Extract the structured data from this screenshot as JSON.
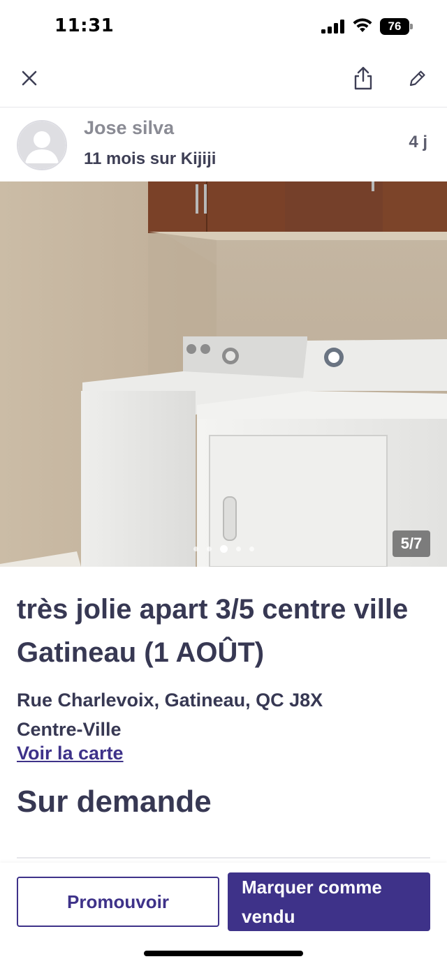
{
  "status_bar": {
    "time": "11:31",
    "battery": "76",
    "icons": [
      "signal-icon",
      "wifi-icon",
      "battery-icon"
    ]
  },
  "top_nav": {
    "icons": [
      "close-icon",
      "share-icon",
      "edit-icon"
    ]
  },
  "seller": {
    "name": "Jose silva",
    "member_since": "11 mois sur Kijiji",
    "posted_age": "4 j"
  },
  "gallery": {
    "counter": "5/7",
    "current_index": 5,
    "total": 7,
    "dot_count": 5,
    "active_dot": 2
  },
  "listing": {
    "title": "très jolie apart 3/5 centre ville Gatineau (1 AOÛT)",
    "address_line1": "Rue Charlevoix, Gatineau, QC J8X",
    "address_line2": "Centre-Ville",
    "map_link": "Voir la carte",
    "price": "Sur demande"
  },
  "actions": {
    "promote_label": "Promouvoir",
    "mark_sold_label": "Marquer comme vendu"
  },
  "colors": {
    "brand": "#3e3289",
    "text": "#373853",
    "muted": "#8a8b94"
  }
}
